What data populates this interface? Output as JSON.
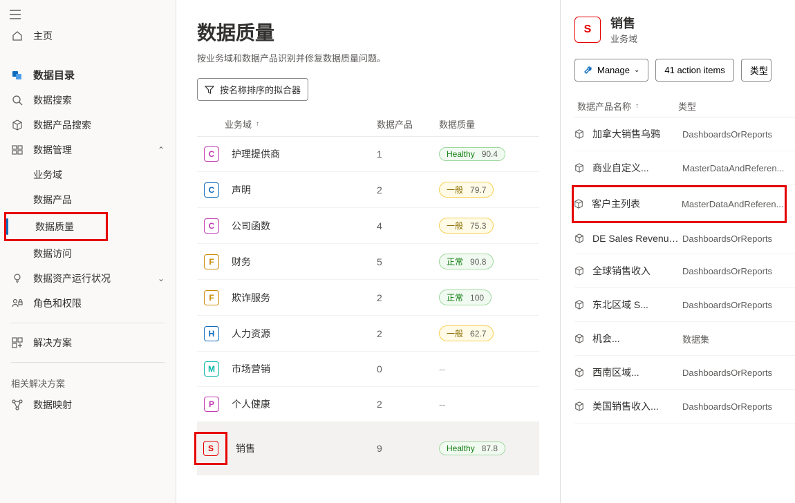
{
  "sidebar": {
    "home": "主页",
    "catalog_section": "数据目录",
    "search": "数据搜索",
    "product_search": "数据产品搜索",
    "manage": "数据管理",
    "manage_children": {
      "domain": "业务域",
      "product": "数据产品",
      "quality": "数据质量",
      "access": "数据访问"
    },
    "asset_status": "数据资产运行状况",
    "roles": "角色和权限",
    "solutions": "解决方案",
    "related_caption": "相关解决方案",
    "mapping": "数据映射"
  },
  "page": {
    "title": "数据质量",
    "subtitle": "按业务域和数据产品识别并修复数据质量问题。",
    "filter_label": "按名称排序的拟合器"
  },
  "table": {
    "col_domain": "业务域",
    "col_count": "数据产品",
    "col_quality": "数据质量"
  },
  "domains": [
    {
      "letter": "C",
      "color": "#c239b3",
      "name": "护理提供商",
      "count": "1",
      "quality_label": "Healthy",
      "quality_value": "90.4",
      "quality_class": "healthy"
    },
    {
      "letter": "C",
      "color": "#0f6cbd",
      "name": "声明",
      "count": "2",
      "quality_label": "一般",
      "quality_value": "79.7",
      "quality_class": "average"
    },
    {
      "letter": "C",
      "color": "#c239b3",
      "name": "公司函数",
      "count": "4",
      "quality_label": "一般",
      "quality_value": "75.3",
      "quality_class": "average"
    },
    {
      "letter": "F",
      "color": "#ca8a04",
      "name": "财务",
      "count": "5",
      "quality_label": "正常",
      "quality_value": "90.8",
      "quality_class": "normal"
    },
    {
      "letter": "F",
      "color": "#ca8a04",
      "name": "欺诈服务",
      "count": "2",
      "quality_label": "正常",
      "quality_value": "100",
      "quality_class": "normal"
    },
    {
      "letter": "H",
      "color": "#0f6cbd",
      "name": "人力资源",
      "count": "2",
      "quality_label": "一般",
      "quality_value": "62.7",
      "quality_class": "average"
    },
    {
      "letter": "M",
      "color": "#00b7a8",
      "name": "市场营销",
      "count": "0",
      "quality_label": "--",
      "quality_value": "",
      "quality_class": "none"
    },
    {
      "letter": "P",
      "color": "#c239b3",
      "name": "个人健康",
      "count": "2",
      "quality_label": "--",
      "quality_value": "",
      "quality_class": "none"
    },
    {
      "letter": "S",
      "color": "#e60000",
      "name": "销售",
      "count": "9",
      "quality_label": "Healthy",
      "quality_value": "87.8",
      "quality_class": "healthy",
      "selected": true,
      "highlight": true
    }
  ],
  "right": {
    "badge_letter": "S",
    "title": "销售",
    "subtitle": "业务域",
    "manage_btn": "Manage",
    "action_items_btn": "41 action items",
    "type_btn": "类型",
    "col_name": "数据产品名称",
    "col_type": "类型",
    "rows": [
      {
        "name": "加拿大销售乌鸦",
        "type": "DashboardsOrReports"
      },
      {
        "name": "商业自定义...",
        "type": "MasterDataAndReferen..."
      },
      {
        "name": "客户主列表",
        "type": "MasterDataAndReferen...",
        "highlight": true
      },
      {
        "name": "DE Sales Revenue In...",
        "type": "DashboardsOrReports"
      },
      {
        "name": "全球销售收入",
        "type": "DashboardsOrReports"
      },
      {
        "name": "东北区域 S...",
        "type": "DashboardsOrReports"
      },
      {
        "name": "机会...",
        "type": "数据集"
      },
      {
        "name": "西南区域...",
        "type": "DashboardsOrReports"
      },
      {
        "name": "美国销售收入...",
        "type": "DashboardsOrReports"
      }
    ]
  }
}
